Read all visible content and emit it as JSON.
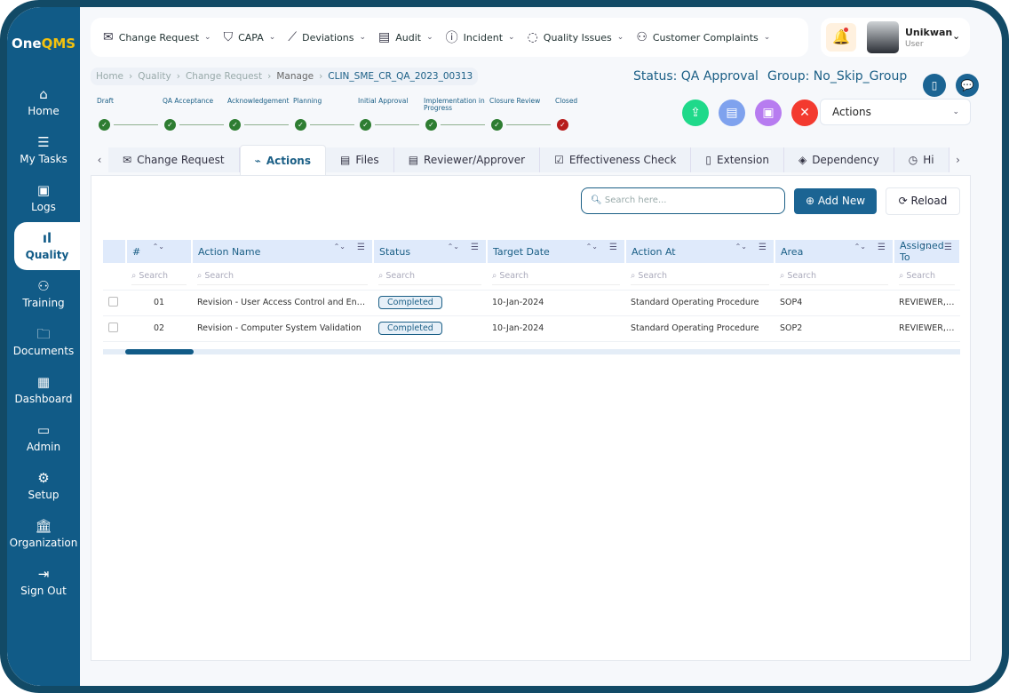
{
  "brand": {
    "one": "One",
    "qms": "QMS"
  },
  "sidebar": {
    "items": [
      {
        "label": "Home",
        "icon": "⌂"
      },
      {
        "label": "My Tasks",
        "icon": "☰"
      },
      {
        "label": "Logs",
        "icon": "▣"
      },
      {
        "label": "Quality",
        "icon": "ıl",
        "active": true
      },
      {
        "label": "Training",
        "icon": "⚇"
      },
      {
        "label": "Documents",
        "icon": "🗀"
      },
      {
        "label": "Dashboard",
        "icon": "▦"
      },
      {
        "label": "Admin",
        "icon": "▭"
      },
      {
        "label": "Setup",
        "icon": "⚙"
      },
      {
        "label": "Organization",
        "icon": "🏛"
      },
      {
        "label": "Sign Out",
        "icon": "⇥"
      }
    ]
  },
  "topnav": [
    {
      "label": "Change Request",
      "icon": "✉"
    },
    {
      "label": "CAPA",
      "icon": "⛉"
    },
    {
      "label": "Deviations",
      "icon": "⟋"
    },
    {
      "label": "Audit",
      "icon": "▤"
    },
    {
      "label": "Incident",
      "icon": "ⓘ"
    },
    {
      "label": "Quality Issues",
      "icon": "◌"
    },
    {
      "label": "Customer Complaints",
      "icon": "⚇"
    }
  ],
  "user": {
    "name": "Unikwan",
    "role": "User"
  },
  "breadcrumb": [
    "Home",
    "Quality",
    "Change Request",
    "Manage",
    "CLIN_SME_CR_QA_2023_00313"
  ],
  "status": "Status: QA Approval",
  "group": "Group: No_Skip_Group",
  "workflow": [
    {
      "label": "Draft",
      "state": "done"
    },
    {
      "label": "QA Acceptance",
      "state": "done"
    },
    {
      "label": "Acknowledgement",
      "state": "done"
    },
    {
      "label": "Planning",
      "state": "done"
    },
    {
      "label": "Initial Approval",
      "state": "done"
    },
    {
      "label": "Implementation in Progress",
      "state": "done"
    },
    {
      "label": "Closure Review",
      "state": "done"
    },
    {
      "label": "Closed",
      "state": "closed"
    }
  ],
  "actions_select": "Actions",
  "tabs": [
    {
      "label": "Change Request",
      "icon": "✉"
    },
    {
      "label": "Actions",
      "icon": "⌁",
      "active": true
    },
    {
      "label": "Files",
      "icon": "▤"
    },
    {
      "label": "Reviewer/Approver",
      "icon": "▤"
    },
    {
      "label": "Effectiveness Check",
      "icon": "☑"
    },
    {
      "label": "Extension",
      "icon": "▯"
    },
    {
      "label": "Dependency",
      "icon": "◈"
    },
    {
      "label": "Hi",
      "icon": "◷"
    }
  ],
  "toolbar": {
    "search_placeholder": "Search here...",
    "add_new": "Add New",
    "reload": "Reload"
  },
  "table": {
    "columns": [
      "#",
      "Action Name",
      "Status",
      "Target Date",
      "Action At",
      "Area",
      "Assigned To"
    ],
    "search_placeholder": "Search",
    "rows": [
      [
        "01",
        "Revision - User Access Control and Enter...",
        "Completed",
        "10-Jan-2024",
        "Standard Operating Procedure",
        "SOP4",
        "REVIEWER, SK"
      ],
      [
        "02",
        "Revision - Computer System Validation",
        "Completed",
        "10-Jan-2024",
        "Standard Operating Procedure",
        "SOP2",
        "REVIEWER, SK"
      ]
    ]
  },
  "colors": {
    "primary": "#1b6493",
    "sidebar": "#115b87",
    "done": "#2e7d32",
    "closed": "#b71c1c"
  }
}
